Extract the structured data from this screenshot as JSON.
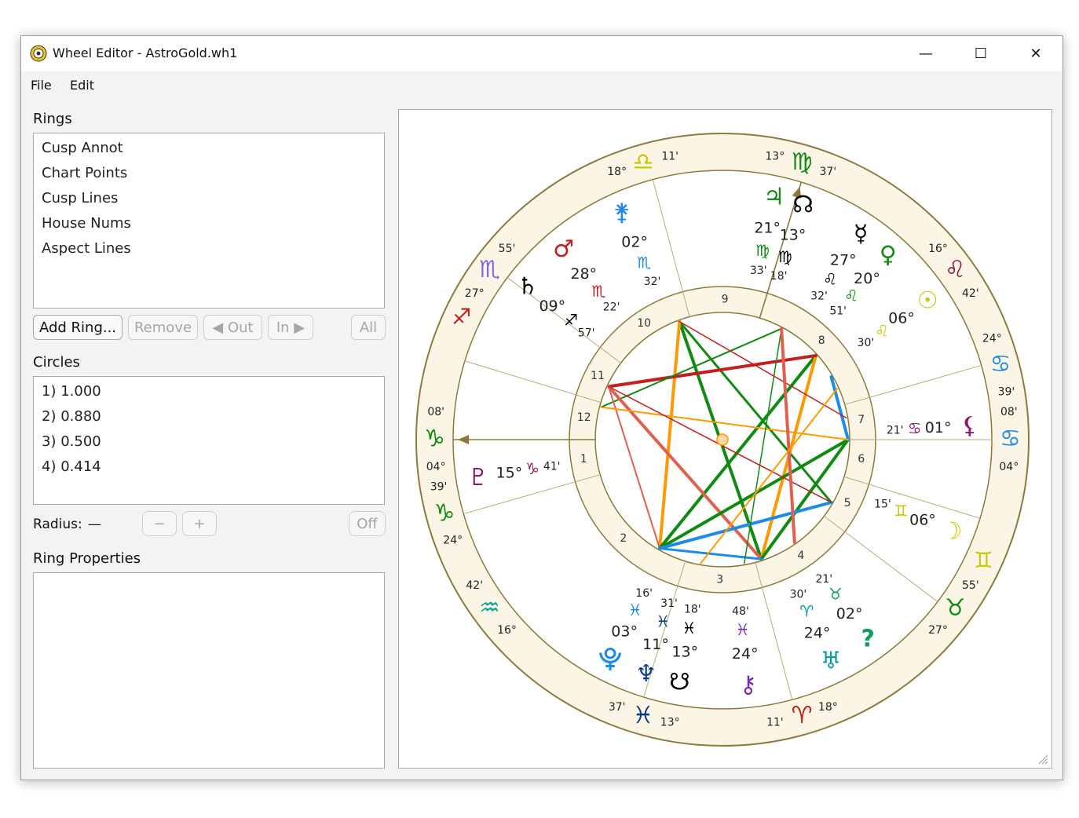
{
  "window": {
    "title": "Wheel Editor - AstroGold.wh1",
    "minimize_glyph": "—",
    "maximize_glyph": "☐",
    "close_glyph": "✕"
  },
  "menubar": {
    "items": [
      "File",
      "Edit"
    ]
  },
  "rings": {
    "heading": "Rings",
    "items": [
      "Cusp Annot",
      "Chart Points",
      "Cusp Lines",
      "House Nums",
      "Aspect Lines"
    ],
    "buttons": {
      "add": "Add Ring...",
      "remove": "Remove",
      "out": "◀ Out",
      "in": "In ▶",
      "all": "All"
    }
  },
  "circles": {
    "heading": "Circles",
    "items": [
      "1) 1.000",
      "2) 0.880",
      "3) 0.500",
      "4) 0.414"
    ],
    "radius_label": "Radius:",
    "radius_value": "—",
    "minus": "−",
    "plus": "+",
    "off": "Off"
  },
  "ring_properties": {
    "heading": "Ring Properties"
  },
  "wheel": {
    "colors": {
      "zodiac_band": "#fbf5e6",
      "border": "#8c7a3c",
      "fire": "#c41e1e",
      "earth": "#118a11",
      "air": "#c8c800",
      "water": "#1e8ce6"
    },
    "zodiac_cusps": [
      {
        "deg": "18°",
        "glyph": "♎",
        "min": "11'",
        "color": "#c8c800",
        "icon": "libra-icon"
      },
      {
        "deg": "13°",
        "glyph": "♍",
        "min": "37'",
        "color": "#118a11",
        "icon": "virgo-icon"
      },
      {
        "deg": "16°",
        "glyph": "♌",
        "min": "42'",
        "color": "#8b1a4a",
        "icon": "leo-icon"
      },
      {
        "deg": "24°",
        "glyph": "♋",
        "min": "39'",
        "color": "#1e8ce6",
        "icon": "cancer-icon"
      },
      {
        "deg": "08'",
        "glyph": "♋",
        "min": "04°",
        "color": "#1e8ce6",
        "icon": "cancer-icon"
      },
      {
        "deg": "55'",
        "glyph": "♉",
        "min": "27°",
        "color": "#118a11",
        "icon": "taurus-icon"
      },
      {
        "deg": "18°",
        "glyph": "♈",
        "min": "11'",
        "color": "#c41e1e",
        "icon": "aries-icon"
      },
      {
        "deg": "13°",
        "glyph": "♓",
        "min": "37'",
        "color": "#0a3d8c",
        "icon": "pisces-icon"
      },
      {
        "deg": "16°",
        "glyph": "♒",
        "min": "42'",
        "color": "#0aa0a0",
        "icon": "aquarius-icon"
      },
      {
        "deg": "24°",
        "glyph": "♑",
        "min": "39'",
        "color": "#118a11",
        "icon": "capricorn-icon"
      },
      {
        "deg": "04°",
        "glyph": "♑",
        "min": "08'",
        "color": "#118a11",
        "icon": "capricorn-icon"
      },
      {
        "deg": "27°",
        "glyph": "♏",
        "min": "55'",
        "color": "#7b6ae0",
        "icon": "scorpio-icon"
      }
    ],
    "extra_glyphs": [
      {
        "glyph": "♐",
        "color": "#c41e1e",
        "icon": "sagittarius-icon"
      },
      {
        "glyph": "♊",
        "color": "#c8c800",
        "icon": "gemini-icon"
      }
    ],
    "house_numbers": [
      "1",
      "2",
      "3",
      "4",
      "5",
      "6",
      "7",
      "8",
      "9",
      "10",
      "11",
      "12"
    ],
    "planets": [
      {
        "glyph": "♃",
        "deg": "21°",
        "sign": "♍",
        "min": "33'",
        "icon": "jupiter-icon",
        "color": "#118a11"
      },
      {
        "glyph": "☊",
        "deg": "13°",
        "sign": "♍",
        "min": "18'",
        "icon": "north-node-icon",
        "color": "#000000"
      },
      {
        "glyph": "☿",
        "deg": "27°",
        "sign": "♌",
        "min": "32'",
        "icon": "mercury-icon",
        "color": "#000000"
      },
      {
        "glyph": "♀",
        "deg": "20°",
        "sign": "♌",
        "min": "51'",
        "icon": "venus-icon",
        "color": "#118a11"
      },
      {
        "glyph": "☉",
        "deg": "06°",
        "sign": "♌",
        "min": "30'",
        "icon": "sun-icon",
        "color": "#c8c800"
      },
      {
        "glyph": "⚸",
        "deg": "01°",
        "sign": "♋",
        "min": "21'",
        "icon": "lilith-icon",
        "color": "#8b1a6a"
      },
      {
        "glyph": "☽",
        "deg": "06°",
        "sign": "♊",
        "min": "15'",
        "icon": "moon-icon",
        "color": "#c8c800"
      },
      {
        "glyph": "?",
        "deg": "02°",
        "sign": "♉",
        "min": "21'",
        "icon": "planet-icon",
        "color": "#0aa060"
      },
      {
        "glyph": "♅",
        "deg": "24°",
        "sign": "♈",
        "min": "30'",
        "icon": "uranus-icon",
        "color": "#0aa0a0"
      },
      {
        "glyph": "⚷",
        "deg": "24°",
        "sign": "♓",
        "min": "48'",
        "icon": "chiron-icon",
        "color": "#7b2ab0"
      },
      {
        "glyph": "☋",
        "deg": "13°",
        "sign": "♓",
        "min": "18'",
        "icon": "south-node-icon",
        "color": "#000000"
      },
      {
        "glyph": "♆",
        "deg": "11°",
        "sign": "♓",
        "min": "31'",
        "icon": "neptune-icon",
        "color": "#0a3d8c"
      },
      {
        "glyph": "⯓",
        "deg": "03°",
        "sign": "♓",
        "min": "16'",
        "icon": "pholus-icon",
        "color": "#1e8ce6"
      },
      {
        "glyph": "♇",
        "deg": "15°",
        "sign": "♑",
        "min": "41'",
        "icon": "pluto-icon",
        "color": "#8b1a6a"
      },
      {
        "glyph": "♄",
        "deg": "09°",
        "sign": "♐",
        "min": "57'",
        "icon": "saturn-icon",
        "color": "#000000"
      },
      {
        "glyph": "♂",
        "deg": "28°",
        "sign": "♏",
        "min": "22'",
        "icon": "mars-icon",
        "color": "#c41e1e"
      },
      {
        "glyph": "⚵",
        "deg": "02°",
        "sign": "♏",
        "min": "32'",
        "icon": "juno-icon",
        "color": "#1e8ce6"
      }
    ]
  }
}
